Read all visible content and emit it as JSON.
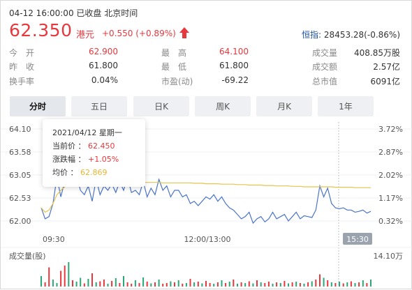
{
  "header": {
    "datetime": "04-12 16:00:00",
    "status": "已收盘",
    "timezone": "北京时间",
    "price": "62.350",
    "currency": "港元",
    "change": "+0.550",
    "change_pct": "(+0.89%)",
    "hsi_label": "恒指:",
    "hsi_value": "28453.28(-0.86%)",
    "accent_color": "#e8383d"
  },
  "stats": {
    "col1": [
      {
        "label": "今　开",
        "value": "62.900",
        "color": "red"
      },
      {
        "label": "昨　收",
        "value": "61.800",
        "color": "normal"
      },
      {
        "label": "换手率",
        "value": "0.04%",
        "color": "normal"
      }
    ],
    "col2": [
      {
        "label": "最　高",
        "value": "64.100",
        "color": "red"
      },
      {
        "label": "最　低",
        "value": "61.800",
        "color": "normal"
      },
      {
        "label": "市盈(动)",
        "value": "-69.22",
        "color": "normal"
      }
    ],
    "col3": [
      {
        "label": "成交量",
        "value": "408.85万股",
        "color": "normal"
      },
      {
        "label": "成交额",
        "value": "2.57亿",
        "color": "normal"
      },
      {
        "label": "总市值",
        "value": "6091亿",
        "color": "normal"
      }
    ]
  },
  "tabs": [
    "分时",
    "五日",
    "日K",
    "周K",
    "月K",
    "1年"
  ],
  "active_tab": "分时",
  "tooltip": {
    "date": "2021/04/12",
    "weekday": "星期一",
    "price_label": "当前价",
    "price_value": "62.450",
    "pct_label": "涨跌幅",
    "pct_value": "+1.05%",
    "avg_label": "均价",
    "avg_value": "62.869"
  },
  "chart_data": {
    "type": "line",
    "y_left_ticks": [
      "64.10",
      "63.58",
      "63.05",
      "62.53",
      "62.00"
    ],
    "y_right_ticks": [
      "3.72%",
      "2.87%",
      "2.02%",
      "1.17%",
      "0.32%"
    ],
    "ylim": [
      62.0,
      64.1
    ],
    "x_ticks": [
      "09:30",
      "12:00/13:00",
      "15:30"
    ],
    "volume_label": "成交量(股)",
    "volume_max_label": "14.10万",
    "series": [
      {
        "role": "price",
        "color": "#4a74c9",
        "values": [
          62.3,
          62.05,
          62.1,
          62.4,
          63.0,
          62.55,
          62.9,
          62.85,
          63.3,
          63.05,
          62.7,
          62.6,
          62.8,
          62.45,
          62.95,
          62.6,
          62.8,
          62.7,
          62.85,
          62.65,
          62.9,
          62.7,
          63.0,
          62.65,
          62.7,
          62.6,
          62.9,
          62.55,
          62.75,
          62.6,
          62.95,
          62.7,
          62.8,
          62.55,
          62.7,
          62.7,
          62.55,
          62.6,
          62.4,
          62.45,
          62.35,
          62.45,
          62.55,
          62.5,
          62.6,
          62.45,
          62.55,
          62.4,
          62.3,
          62.25,
          62.15,
          62.05,
          62.1,
          62.2,
          61.95,
          62.05,
          62.1,
          61.98,
          62.05,
          62.2,
          62.05,
          62.1,
          62.15,
          62.0,
          62.1,
          62.2,
          62.05,
          62.12,
          62.1,
          62.08,
          62.25,
          62.8,
          62.55,
          62.75,
          62.4,
          62.3,
          62.28,
          62.3,
          62.25,
          62.25,
          62.2,
          62.22,
          62.25,
          62.18,
          62.22
        ]
      },
      {
        "role": "average",
        "color": "#e6c34a",
        "values": [
          62.3,
          62.2,
          62.25,
          62.4,
          62.6,
          62.7,
          62.78,
          62.85,
          62.9,
          62.92,
          62.92,
          62.92,
          62.9,
          62.9,
          62.9,
          62.9,
          62.89,
          62.89,
          62.89,
          62.89,
          62.89,
          62.89,
          62.89,
          62.88,
          62.88,
          62.88,
          62.88,
          62.88,
          62.88,
          62.88,
          62.88,
          62.87,
          62.87,
          62.87,
          62.87,
          62.87,
          62.87,
          62.87,
          62.87,
          62.86,
          62.86,
          62.86,
          62.85,
          62.85,
          62.85,
          62.85,
          62.84,
          62.84,
          62.84,
          62.84,
          62.83,
          62.83,
          62.83,
          62.82,
          62.82,
          62.82,
          62.82,
          62.81,
          62.81,
          62.81,
          62.8,
          62.8,
          62.8,
          62.8,
          62.79,
          62.79,
          62.79,
          62.78,
          62.78,
          62.78,
          62.78,
          62.78,
          62.78,
          62.78,
          62.78,
          62.77,
          62.77,
          62.77,
          62.77,
          62.77,
          62.76,
          62.76,
          62.76,
          62.76,
          62.76
        ]
      }
    ],
    "volume": [
      30,
      12,
      55,
      20,
      10,
      45,
      60,
      70,
      18,
      14,
      25,
      9,
      22,
      38,
      12,
      15,
      20,
      8,
      16,
      24,
      10,
      30,
      12,
      8,
      18,
      10,
      26,
      14,
      9,
      12,
      20,
      8,
      10,
      15,
      12,
      18,
      8,
      10,
      22,
      12,
      14,
      9,
      16,
      10,
      8,
      12,
      18,
      10,
      14,
      20,
      8,
      12,
      10,
      15,
      9,
      18,
      12,
      10,
      14,
      8,
      12,
      10,
      16,
      9,
      12,
      14,
      10,
      8,
      12,
      15,
      20,
      35,
      25,
      18,
      12,
      10,
      14,
      9,
      12,
      15,
      10,
      12,
      18,
      10,
      20
    ],
    "volume_colors": [
      "green",
      "red",
      "red",
      "green",
      "green",
      "red",
      "red",
      "green",
      "red",
      "green",
      "green",
      "red",
      "green",
      "red",
      "green",
      "red",
      "red",
      "green",
      "red",
      "green",
      "red",
      "green",
      "red",
      "red",
      "green",
      "red",
      "green",
      "red",
      "green",
      "red",
      "green",
      "red",
      "red",
      "green",
      "red",
      "green",
      "red",
      "green",
      "red",
      "green",
      "red",
      "green",
      "red",
      "red",
      "green",
      "red",
      "green",
      "red",
      "green",
      "red",
      "green",
      "red",
      "green",
      "red",
      "green",
      "red",
      "green",
      "red",
      "red",
      "green",
      "red",
      "green",
      "red",
      "green",
      "red",
      "green",
      "red",
      "green",
      "red",
      "green",
      "red",
      "red",
      "green",
      "red",
      "green",
      "red",
      "green",
      "red",
      "green",
      "red",
      "green",
      "red",
      "green",
      "red",
      "green"
    ]
  }
}
